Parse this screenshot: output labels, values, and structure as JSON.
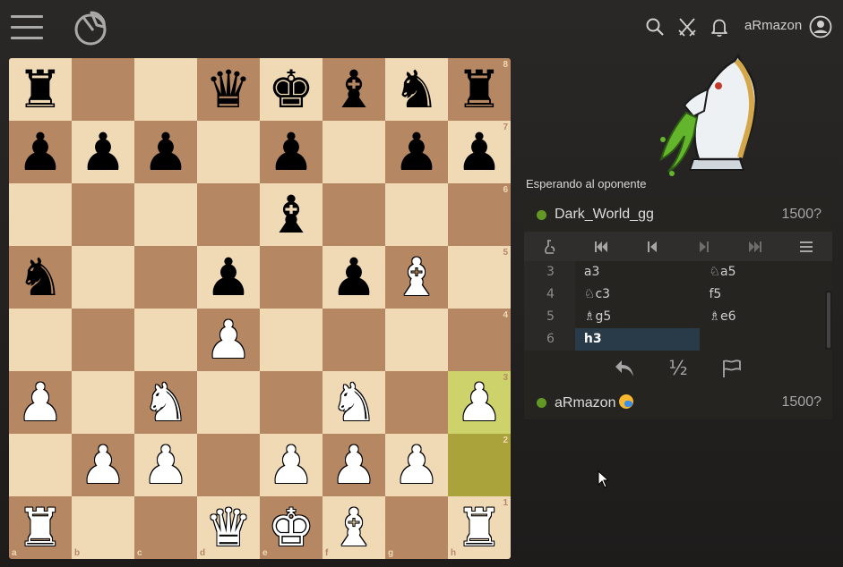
{
  "header": {
    "username": "aRmazon",
    "icons": [
      "menu-icon",
      "logo-icon",
      "search-icon",
      "swords-icon",
      "bell-icon",
      "user-icon"
    ]
  },
  "board": {
    "ranks": [
      "8",
      "7",
      "6",
      "5",
      "4",
      "3",
      "2",
      "1"
    ],
    "files": [
      "a",
      "b",
      "c",
      "d",
      "e",
      "f",
      "g",
      "h"
    ],
    "last_move": [
      "h2",
      "h3"
    ],
    "position": [
      [
        "♜",
        "",
        "",
        "♛",
        "♚",
        "♝",
        "♞",
        "♜"
      ],
      [
        "♟",
        "♟",
        "♟",
        "",
        "♟",
        "",
        "♟",
        "♟"
      ],
      [
        "",
        "",
        "",
        "",
        "♝",
        "",
        "",
        ""
      ],
      [
        "♞",
        "",
        "",
        "♟",
        "",
        "♟",
        "♗",
        ""
      ],
      [
        "",
        "",
        "",
        "♙",
        "",
        "",
        "",
        ""
      ],
      [
        "♙",
        "",
        "♘",
        "",
        "",
        "♘",
        "",
        "♙"
      ],
      [
        "",
        "♙",
        "♙",
        "",
        "♙",
        "♙",
        "♙",
        ""
      ],
      [
        "♖",
        "",
        "",
        "♕",
        "♔",
        "♗",
        "",
        "♖"
      ]
    ]
  },
  "status_text": "Esperando al oponente",
  "opponent": {
    "name": "Dark_World_gg",
    "rating": "1500?"
  },
  "player": {
    "name": "aRmazon",
    "rating": "1500?"
  },
  "controls": [
    "analysis-icon",
    "first-move-icon",
    "prev-move-icon",
    "next-move-icon",
    "last-move-icon",
    "menu-icon"
  ],
  "moves": [
    {
      "num": "3",
      "white": "a3",
      "black": "♘a5"
    },
    {
      "num": "4",
      "white": "♘c3",
      "black": "f5"
    },
    {
      "num": "5",
      "white": "♗g5",
      "black": "♗e6"
    },
    {
      "num": "6",
      "white": "h3",
      "black": ""
    }
  ],
  "actions": {
    "takeback": "↶",
    "draw": "½",
    "resign": "⚐"
  },
  "colors": {
    "light_square": "#f0d9b5",
    "dark_square": "#b58863",
    "highlight_light": "#cdd26a",
    "highlight_dark": "#aaa23a",
    "online": "#629924",
    "active_move": "#293a49"
  }
}
